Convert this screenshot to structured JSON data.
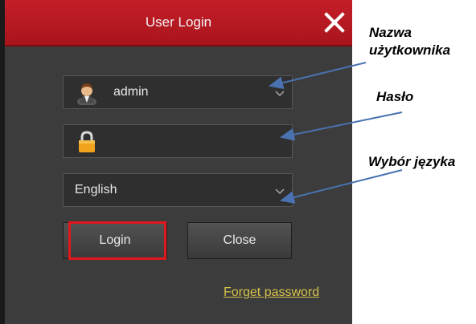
{
  "dialog": {
    "title": "User Login",
    "close_icon": "close-icon",
    "username": {
      "icon": "user-avatar-icon",
      "value": "admin",
      "dropdown_icon": "chevron-down-icon"
    },
    "password": {
      "icon": "padlock-icon",
      "value": ""
    },
    "language": {
      "value": "English",
      "dropdown_icon": "chevron-down-icon"
    },
    "buttons": {
      "login": "Login",
      "close": "Close"
    },
    "forget_password": "Forget password"
  },
  "annotations": {
    "username_label_line1": "Nazwa",
    "username_label_line2": "użytkownika",
    "password_label": "Hasło",
    "language_label": "Wybór języka"
  },
  "colors": {
    "titlebar": "#b5161f",
    "dialog_bg": "#3c3c3c",
    "highlight": "#e2161d",
    "link": "#d6c24a",
    "arrow": "#4a72b0"
  }
}
